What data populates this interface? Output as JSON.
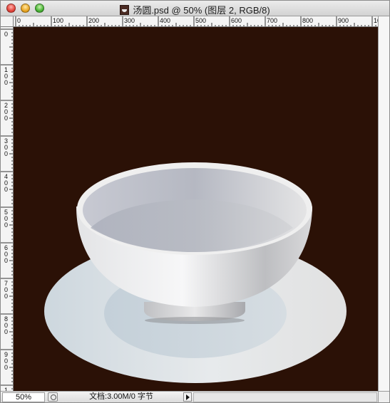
{
  "window": {
    "title": "汤圆.psd @ 50% (图层 2, RGB/8)",
    "doc_icon": "psd-document-icon"
  },
  "ruler": {
    "horizontal_labels": [
      "0",
      "100",
      "200",
      "300",
      "400",
      "500",
      "600",
      "700",
      "800",
      "900",
      "10"
    ],
    "vertical_labels": [
      "0",
      "100",
      "200",
      "300",
      "400",
      "500",
      "600",
      "700",
      "800",
      "900",
      "1"
    ]
  },
  "canvas": {
    "background": "#2b1106",
    "content": "bowl-on-saucer-illustration"
  },
  "status": {
    "zoom": "50%",
    "doc_info": "文档:3.00M/0 字节"
  },
  "colors": {
    "close": "#e3443b",
    "minimize": "#e9a623",
    "maximize": "#49b435"
  }
}
